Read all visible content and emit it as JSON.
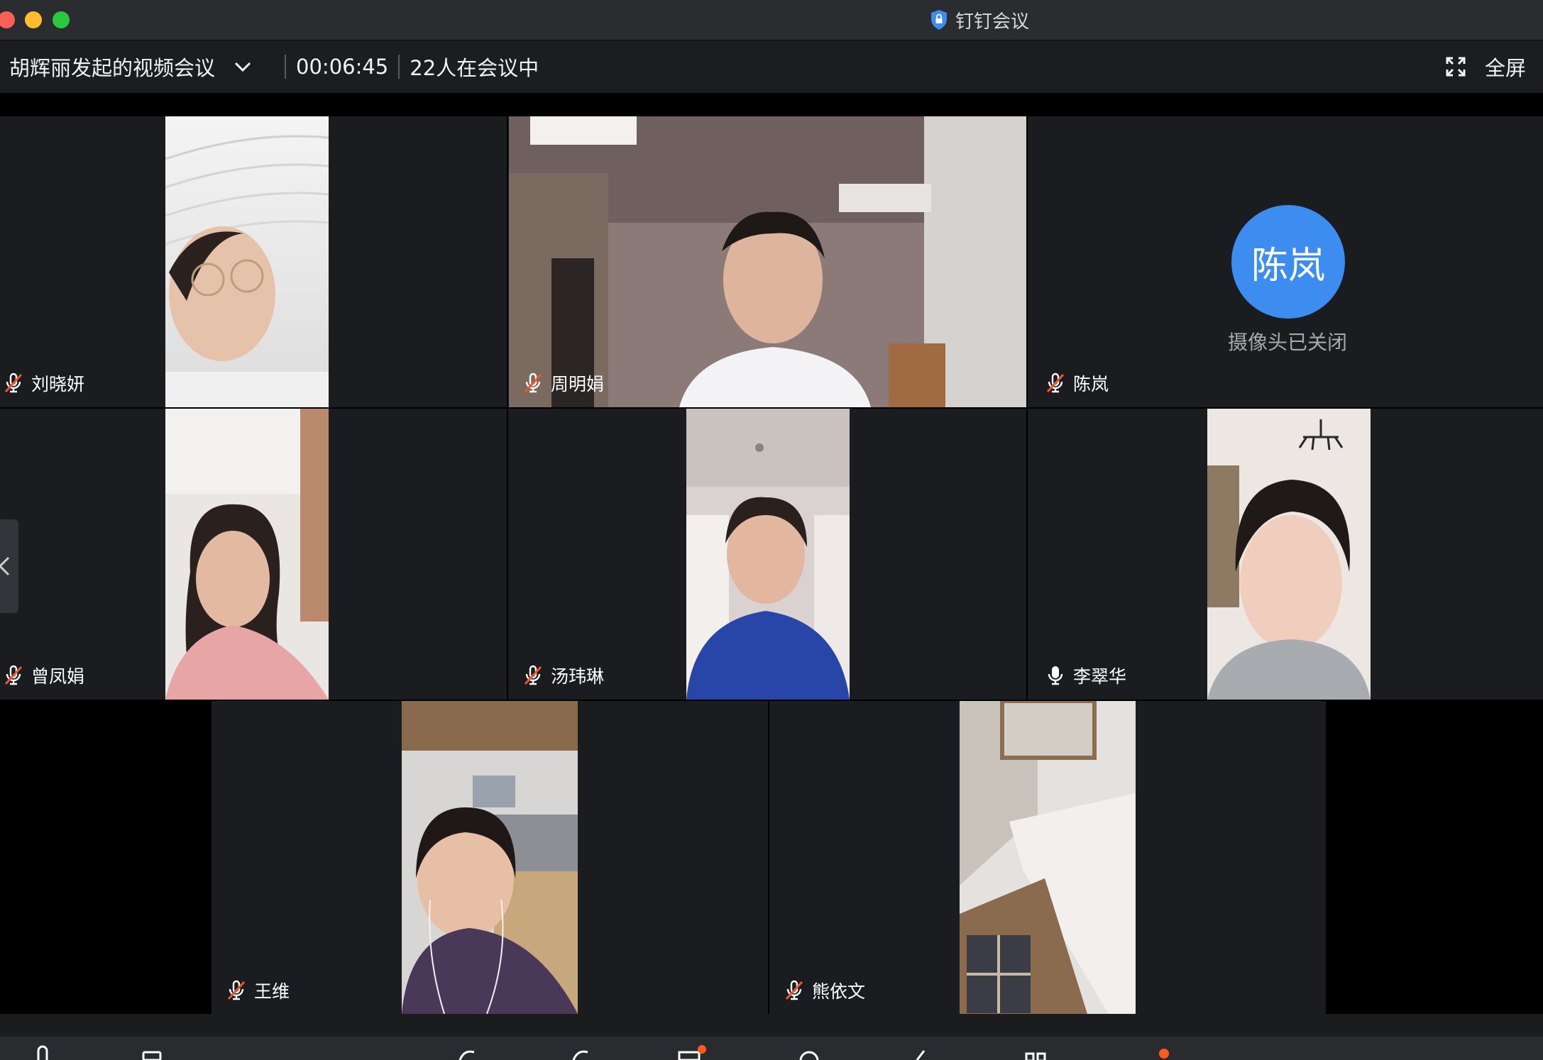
{
  "window": {
    "app_title": "钉钉会议"
  },
  "meeting": {
    "title": "胡辉丽发起的视频会议",
    "elapsed": "00:06:45",
    "participants_count": "22人在会议中",
    "fullscreen_label": "全屏"
  },
  "participants": [
    {
      "name": "刘晓妍",
      "mic": "muted",
      "camera": "on"
    },
    {
      "name": "周明娟",
      "mic": "muted",
      "camera": "on"
    },
    {
      "name": "陈岚",
      "mic": "muted",
      "camera": "off",
      "avatar_text": "陈岚",
      "camera_off_text": "摄像头已关闭"
    },
    {
      "name": "曾凤娟",
      "mic": "muted",
      "camera": "on"
    },
    {
      "name": "汤玮琳",
      "mic": "muted",
      "camera": "on"
    },
    {
      "name": "李翠华",
      "mic": "on",
      "camera": "on"
    },
    {
      "name": "王维",
      "mic": "muted",
      "camera": "on"
    },
    {
      "name": "熊依文",
      "mic": "muted",
      "camera": "on"
    }
  ],
  "colors": {
    "avatar_blue": "#3d8cf0",
    "mute_red": "#f0532d",
    "notify_orange": "#ff5a1f"
  },
  "icons": {
    "muted": "mic-muted-icon",
    "unmuted": "mic-icon",
    "fullscreen": "fullscreen-icon",
    "dropdown": "chevron-down-icon",
    "collapse": "chevron-left-icon"
  }
}
